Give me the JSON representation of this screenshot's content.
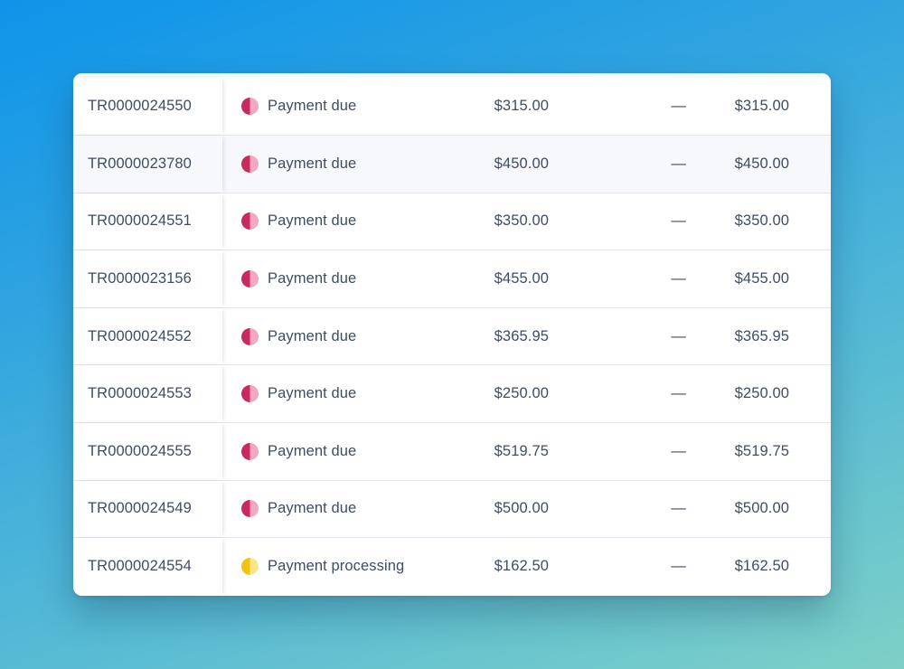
{
  "colors": {
    "due_dark": "#c9295c",
    "due_light": "#f2a9bf",
    "processing_dark": "#f2c40c",
    "processing_light": "#fbe78a",
    "text": "#3f4d64"
  },
  "rows": [
    {
      "id": "TR0000024550",
      "status": "Payment due",
      "status_type": "due",
      "amount": "$315.00",
      "adjustment": "—",
      "total": "$315.00"
    },
    {
      "id": "TR0000023780",
      "status": "Payment due",
      "status_type": "due",
      "amount": "$450.00",
      "adjustment": "—",
      "total": "$450.00"
    },
    {
      "id": "TR0000024551",
      "status": "Payment due",
      "status_type": "due",
      "amount": "$350.00",
      "adjustment": "—",
      "total": "$350.00"
    },
    {
      "id": "TR0000023156",
      "status": "Payment due",
      "status_type": "due",
      "amount": "$455.00",
      "adjustment": "—",
      "total": "$455.00"
    },
    {
      "id": "TR0000024552",
      "status": "Payment due",
      "status_type": "due",
      "amount": "$365.95",
      "adjustment": "—",
      "total": "$365.95"
    },
    {
      "id": "TR0000024553",
      "status": "Payment due",
      "status_type": "due",
      "amount": "$250.00",
      "adjustment": "—",
      "total": "$250.00"
    },
    {
      "id": "TR0000024555",
      "status": "Payment due",
      "status_type": "due",
      "amount": "$519.75",
      "adjustment": "—",
      "total": "$519.75"
    },
    {
      "id": "TR0000024549",
      "status": "Payment due",
      "status_type": "due",
      "amount": "$500.00",
      "adjustment": "—",
      "total": "$500.00"
    },
    {
      "id": "TR0000024554",
      "status": "Payment processing",
      "status_type": "processing",
      "amount": "$162.50",
      "adjustment": "—",
      "total": "$162.50"
    }
  ]
}
